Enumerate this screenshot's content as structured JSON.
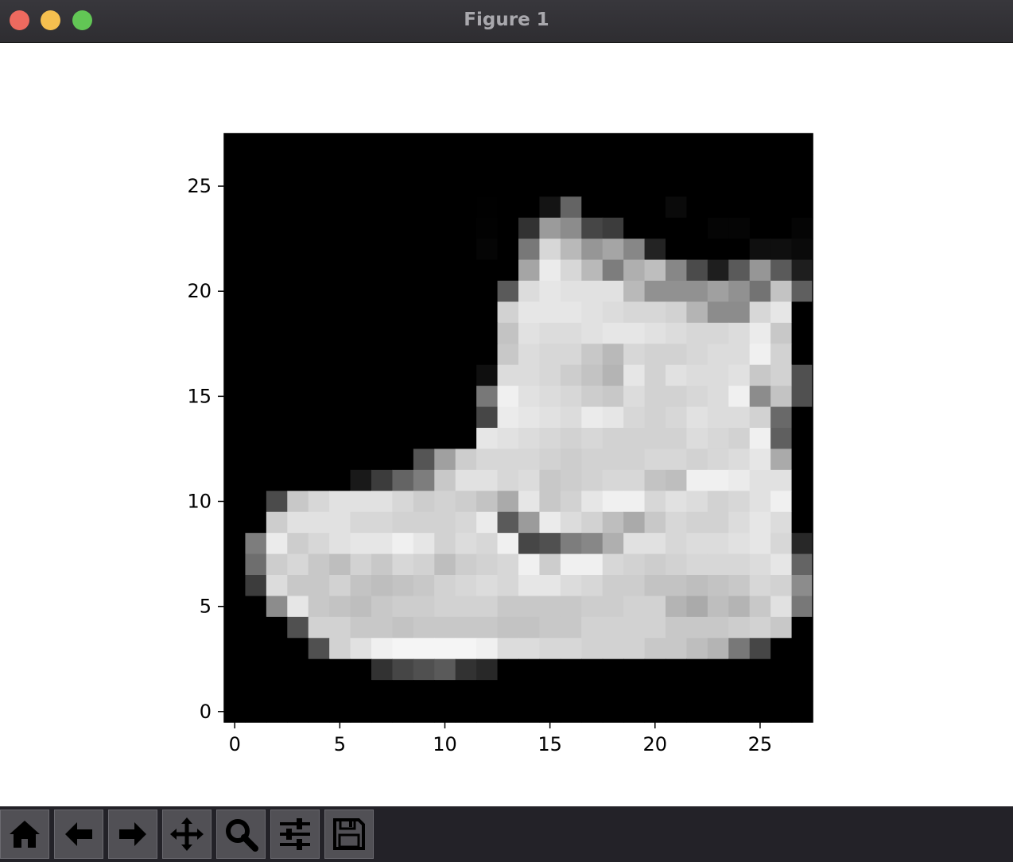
{
  "window": {
    "title": "Figure 1"
  },
  "toolbar": {
    "buttons": [
      {
        "name": "home",
        "icon": "home-icon"
      },
      {
        "name": "back",
        "icon": "arrow-left-icon"
      },
      {
        "name": "forward",
        "icon": "arrow-right-icon"
      },
      {
        "name": "pan",
        "icon": "move-icon"
      },
      {
        "name": "zoom",
        "icon": "magnifier-icon"
      },
      {
        "name": "configure-subplots",
        "icon": "sliders-icon"
      },
      {
        "name": "save",
        "icon": "floppy-disk-icon"
      }
    ]
  },
  "chart_data": {
    "type": "heatmap",
    "colormap": "gray",
    "rows": 28,
    "cols": 28,
    "xlim": [
      -0.5,
      27.5
    ],
    "ylim": [
      27.5,
      -0.5
    ],
    "xticks": [
      "0",
      "5",
      "10",
      "15",
      "20",
      "25"
    ],
    "yticks": [
      "0",
      "5",
      "10",
      "15",
      "20",
      "25"
    ],
    "grid": false,
    "values": [
      [
        0,
        0,
        0,
        0,
        0,
        0,
        0,
        0,
        0,
        0,
        0,
        0,
        0,
        0,
        0,
        0,
        0,
        0,
        0,
        0,
        0,
        0,
        0,
        0,
        0,
        0,
        0,
        0
      ],
      [
        0,
        0,
        0,
        0,
        0,
        0,
        0,
        0,
        0,
        0,
        0,
        0,
        0,
        0,
        0,
        0,
        0,
        0,
        0,
        0,
        0,
        0,
        0,
        0,
        0,
        0,
        0,
        0
      ],
      [
        0,
        0,
        0,
        0,
        0,
        0,
        0,
        0,
        0,
        0,
        0,
        0,
        0,
        0,
        0,
        0,
        0,
        0,
        0,
        0,
        0,
        0,
        0,
        0,
        0,
        0,
        0,
        0
      ],
      [
        0,
        0,
        0,
        0,
        0,
        0,
        0,
        0,
        0,
        0,
        0,
        0,
        1,
        0,
        0,
        20,
        100,
        0,
        0,
        0,
        0,
        10,
        0,
        0,
        0,
        0,
        0,
        0
      ],
      [
        0,
        0,
        0,
        0,
        0,
        0,
        0,
        0,
        0,
        0,
        0,
        0,
        2,
        0,
        50,
        155,
        140,
        70,
        60,
        0,
        0,
        0,
        0,
        5,
        5,
        0,
        0,
        5
      ],
      [
        0,
        0,
        0,
        0,
        0,
        0,
        0,
        0,
        0,
        0,
        0,
        0,
        5,
        0,
        120,
        215,
        185,
        150,
        165,
        135,
        35,
        0,
        0,
        0,
        0,
        15,
        15,
        10
      ],
      [
        0,
        0,
        0,
        0,
        0,
        0,
        0,
        0,
        0,
        0,
        0,
        0,
        0,
        0,
        165,
        235,
        215,
        185,
        125,
        175,
        190,
        135,
        75,
        30,
        90,
        150,
        90,
        30
      ],
      [
        0,
        0,
        0,
        0,
        0,
        0,
        0,
        0,
        0,
        0,
        0,
        0,
        0,
        90,
        220,
        230,
        225,
        225,
        225,
        185,
        145,
        145,
        145,
        160,
        145,
        115,
        195,
        95
      ],
      [
        0,
        0,
        0,
        0,
        0,
        0,
        0,
        0,
        0,
        0,
        0,
        0,
        0,
        210,
        230,
        230,
        230,
        225,
        220,
        215,
        215,
        210,
        180,
        140,
        140,
        215,
        230,
        0
      ],
      [
        0,
        0,
        0,
        0,
        0,
        0,
        0,
        0,
        0,
        0,
        0,
        0,
        0,
        195,
        225,
        220,
        220,
        225,
        230,
        230,
        225,
        220,
        215,
        215,
        220,
        235,
        200,
        0
      ],
      [
        0,
        0,
        0,
        0,
        0,
        0,
        0,
        0,
        0,
        0,
        0,
        0,
        0,
        200,
        220,
        215,
        215,
        200,
        185,
        215,
        210,
        210,
        215,
        220,
        220,
        240,
        210,
        0
      ],
      [
        0,
        0,
        0,
        0,
        0,
        0,
        0,
        0,
        0,
        0,
        0,
        0,
        15,
        220,
        220,
        215,
        205,
        195,
        180,
        230,
        210,
        225,
        220,
        220,
        225,
        200,
        210,
        80
      ],
      [
        0,
        0,
        0,
        0,
        0,
        0,
        0,
        0,
        0,
        0,
        0,
        0,
        120,
        240,
        225,
        220,
        215,
        205,
        200,
        220,
        210,
        210,
        215,
        220,
        240,
        140,
        195,
        80
      ],
      [
        0,
        0,
        0,
        0,
        0,
        0,
        0,
        0,
        0,
        0,
        0,
        0,
        70,
        235,
        230,
        225,
        220,
        235,
        230,
        215,
        210,
        215,
        225,
        220,
        220,
        210,
        105,
        0
      ],
      [
        0,
        0,
        0,
        0,
        0,
        0,
        0,
        0,
        0,
        0,
        0,
        0,
        230,
        225,
        220,
        215,
        210,
        215,
        210,
        210,
        210,
        210,
        220,
        215,
        210,
        240,
        95,
        0
      ],
      [
        0,
        0,
        0,
        0,
        0,
        0,
        0,
        0,
        0,
        85,
        160,
        205,
        215,
        215,
        215,
        210,
        205,
        210,
        210,
        210,
        215,
        215,
        210,
        215,
        220,
        230,
        170,
        0
      ],
      [
        0,
        0,
        0,
        0,
        0,
        0,
        25,
        60,
        100,
        125,
        200,
        225,
        225,
        215,
        220,
        200,
        205,
        210,
        215,
        215,
        195,
        190,
        240,
        240,
        235,
        225,
        225,
        0
      ],
      [
        0,
        0,
        75,
        200,
        215,
        225,
        225,
        225,
        215,
        205,
        210,
        205,
        195,
        170,
        230,
        200,
        210,
        230,
        240,
        240,
        215,
        225,
        220,
        210,
        215,
        225,
        240,
        0
      ],
      [
        0,
        0,
        205,
        225,
        225,
        225,
        215,
        215,
        210,
        210,
        210,
        215,
        235,
        90,
        155,
        235,
        220,
        210,
        190,
        170,
        200,
        215,
        210,
        210,
        220,
        230,
        220,
        0
      ],
      [
        0,
        125,
        235,
        205,
        215,
        225,
        230,
        230,
        240,
        230,
        210,
        220,
        215,
        240,
        70,
        80,
        125,
        135,
        175,
        225,
        225,
        215,
        220,
        220,
        225,
        230,
        215,
        40
      ],
      [
        0,
        110,
        205,
        215,
        200,
        190,
        210,
        200,
        215,
        210,
        190,
        205,
        210,
        215,
        240,
        205,
        240,
        240,
        215,
        210,
        205,
        210,
        215,
        215,
        215,
        220,
        230,
        100
      ],
      [
        0,
        60,
        220,
        200,
        200,
        210,
        195,
        190,
        195,
        200,
        210,
        215,
        220,
        215,
        230,
        230,
        220,
        215,
        205,
        205,
        195,
        195,
        190,
        195,
        200,
        215,
        210,
        140
      ],
      [
        0,
        0,
        140,
        230,
        200,
        195,
        190,
        200,
        205,
        205,
        210,
        210,
        210,
        200,
        200,
        200,
        200,
        205,
        205,
        210,
        210,
        180,
        170,
        190,
        180,
        200,
        225,
        120
      ],
      [
        0,
        0,
        0,
        80,
        210,
        210,
        200,
        200,
        195,
        200,
        200,
        200,
        200,
        195,
        195,
        200,
        200,
        210,
        210,
        210,
        210,
        200,
        200,
        200,
        205,
        210,
        200,
        0
      ],
      [
        0,
        0,
        0,
        0,
        80,
        210,
        225,
        240,
        245,
        245,
        245,
        245,
        240,
        220,
        220,
        215,
        215,
        210,
        210,
        210,
        200,
        200,
        190,
        180,
        120,
        70,
        0,
        0
      ],
      [
        0,
        0,
        0,
        0,
        0,
        0,
        0,
        50,
        70,
        80,
        90,
        50,
        40,
        0,
        0,
        0,
        0,
        0,
        0,
        0,
        0,
        0,
        0,
        0,
        0,
        0,
        0,
        0
      ],
      [
        0,
        0,
        0,
        0,
        0,
        0,
        0,
        0,
        0,
        0,
        0,
        0,
        0,
        0,
        0,
        0,
        0,
        0,
        0,
        0,
        0,
        0,
        0,
        0,
        0,
        0,
        0,
        0
      ],
      [
        0,
        0,
        0,
        0,
        0,
        0,
        0,
        0,
        0,
        0,
        0,
        0,
        0,
        0,
        0,
        0,
        0,
        0,
        0,
        0,
        0,
        0,
        0,
        0,
        0,
        0,
        0,
        0
      ]
    ]
  }
}
